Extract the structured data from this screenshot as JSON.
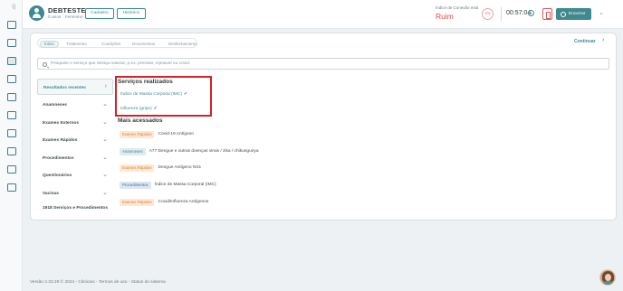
{
  "sidebar": {
    "toggle_icon": "collapse-icon",
    "icons": [
      "home-icon",
      "chart-icon",
      "stethoscope-icon",
      "calendar-icon",
      "building-icon",
      "users-icon",
      "folder-icon",
      "bank-icon",
      "id-card-icon",
      "search-doc-icon"
    ]
  },
  "header": {
    "patient_name": "DEBTESTE",
    "patient_info": "0 anos · Feminino",
    "cadastro_label": "Cadastro",
    "historico_label": "Histórico",
    "risk_label": "Índice de Conexão está",
    "risk_value": "Ruim",
    "risk_percent": "0%",
    "timer": "00:57:04",
    "encerrar_label": "Encerrar"
  },
  "tabs": [
    {
      "label": "Início",
      "active": true
    },
    {
      "label": "Tratamento",
      "active": false
    },
    {
      "label": "Condições",
      "active": false
    },
    {
      "label": "Documentos",
      "active": false
    },
    {
      "label": "Desfechamento",
      "active": false
    }
  ],
  "continuar_label": "Continuar",
  "search": {
    "placeholder": "Pesquise o serviço que deseja realizar, p.ex: pressão, injetável ou covid."
  },
  "categories": [
    {
      "label": "Resultados recentes",
      "selected": true
    },
    {
      "label": "Anamneses"
    },
    {
      "label": "Exames Externos"
    },
    {
      "label": "Exames Rápidos"
    },
    {
      "label": "Procedimentos"
    },
    {
      "label": "Questionários"
    },
    {
      "label": "Vacinas"
    },
    {
      "label": "1918 Serviços e Procedimentos"
    }
  ],
  "servicos_realizados": {
    "title": "Serviços realizados",
    "items": [
      "Índice de Massa Corporal (IMC)",
      "Influenza (gripe)"
    ]
  },
  "mais_acessados": {
    "title": "Mais acessados",
    "items": [
      {
        "badge": "Exames Rápidos",
        "badge_color": "orange",
        "text": "Covid-19 Antígeno"
      },
      {
        "badge": "Anamneses",
        "badge_color": "teal",
        "text": "A77 Dengue e outras doenças virais / zika / chikungunya"
      },
      {
        "badge": "Exames Rápidos",
        "badge_color": "orange",
        "text": "Dengue Antígeno NS1"
      },
      {
        "badge": "Procedimentos",
        "badge_color": "blue",
        "text": "Índice de Massa Corporal (IMC)"
      },
      {
        "badge": "Exames Rápidos",
        "badge_color": "orange",
        "text": "Covid/Influenza Antígenos"
      }
    ]
  },
  "footer": {
    "text": "Versão 2.33.29 © 2024 - Clinicarx - Termos de uso - Status do sistema"
  },
  "colors": {
    "primary": "#3f8a8e",
    "danger": "#e04b4b",
    "highlight_border": "#d6212a"
  }
}
